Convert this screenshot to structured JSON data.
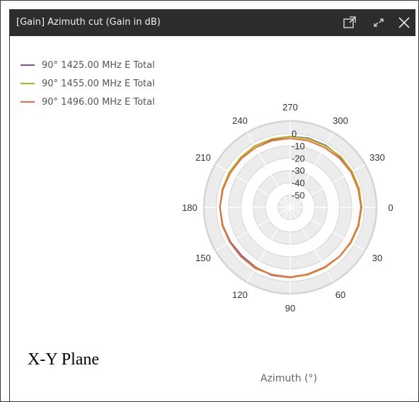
{
  "window": {
    "title": "[Gain] Azimuth cut (Gain in dB)",
    "buttons": [
      {
        "icon": "popout-icon"
      },
      {
        "icon": "expand-icon"
      },
      {
        "icon": "close-icon"
      }
    ]
  },
  "caption": "X-Y Plane",
  "colors": {
    "titlebar_bg": "#2d2d30",
    "series1": "#7b4fa0",
    "series2": "#a8b820",
    "series3": "#f06a3c",
    "ring_shade": "#ececec"
  },
  "chart_data": {
    "type": "polar-line",
    "title": "",
    "angle_label": "Azimuth (°)",
    "angle_ticks": [
      "0",
      "30",
      "60",
      "90",
      "120",
      "150",
      "180",
      "210",
      "240",
      "270",
      "300",
      "330"
    ],
    "angle_tick_values": [
      0,
      30,
      60,
      90,
      120,
      150,
      180,
      210,
      240,
      270,
      300,
      330
    ],
    "angle_direction": "clockwise, 0 at right",
    "radial_ticks": [
      "0",
      "-10",
      "-20",
      "-30",
      "-40",
      "-50"
    ],
    "radial_range": [
      -60,
      10
    ],
    "grid": true,
    "legend_position": "top-left",
    "angles": [
      0,
      15,
      30,
      45,
      60,
      75,
      90,
      105,
      120,
      135,
      150,
      165,
      180,
      195,
      210,
      225,
      240,
      255,
      270,
      285,
      300,
      315,
      330,
      345
    ],
    "series": [
      {
        "name": "90° 1425.00 MHz E Total",
        "color": "#7b4fa0",
        "values": [
          -2.5,
          -2.5,
          -3,
          -3.5,
          -4,
          -4,
          -3,
          -3,
          -4,
          -4.5,
          -4,
          -3.5,
          -3,
          -3.5,
          -3.5,
          -3,
          -2.5,
          -3,
          -2.5,
          -2,
          -2,
          -2.5,
          -2.5,
          -2.5
        ]
      },
      {
        "name": "90° 1455.00 MHz E Total",
        "color": "#a8b820",
        "values": [
          -2,
          -2.5,
          -3,
          -3.5,
          -3.5,
          -3.5,
          -3,
          -3.5,
          -3.5,
          -3.5,
          -3.5,
          -3.5,
          -3,
          -3,
          -3,
          -3,
          -2.5,
          -2.5,
          -2.5,
          -2.5,
          -2.5,
          -2,
          -2,
          -2
        ]
      },
      {
        "name": "90° 1496.00 MHz E Total",
        "color": "#f06a3c",
        "values": [
          -2.5,
          -3,
          -3.5,
          -3.5,
          -4,
          -4,
          -3.5,
          -3.5,
          -3,
          -3.5,
          -3.5,
          -3,
          -3,
          -3.5,
          -4,
          -4,
          -4,
          -4,
          -4,
          -4,
          -4,
          -3.5,
          -3,
          -3
        ]
      }
    ]
  }
}
